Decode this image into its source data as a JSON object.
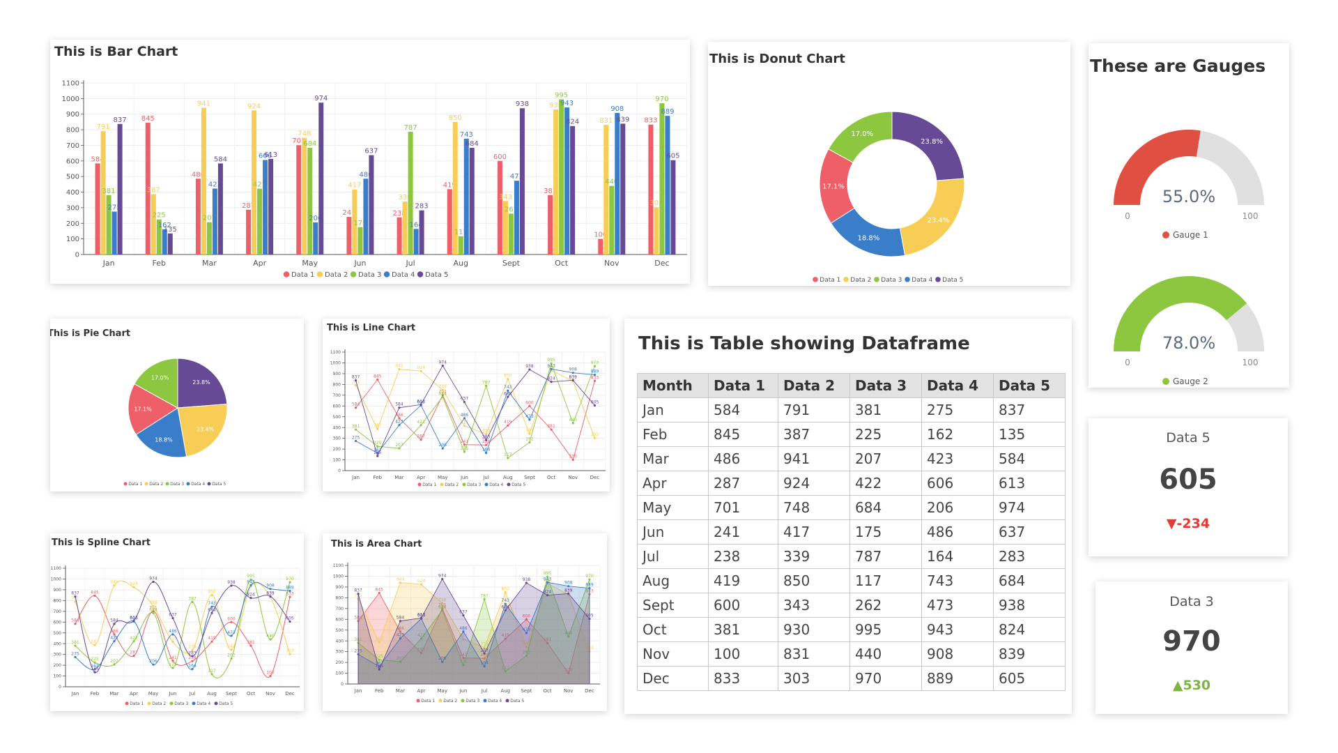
{
  "colors": [
    "#ee5f67",
    "#f7cd56",
    "#8dc63f",
    "#3a7dc9",
    "#674a95"
  ],
  "legend": [
    "Data 1",
    "Data 2",
    "Data 3",
    "Data 4",
    "Data 5"
  ],
  "months_short": [
    "Jan",
    "Feb",
    "Mar",
    "Apr",
    "May",
    "Jun",
    "Jul",
    "Aug",
    "Sept",
    "Oct",
    "Nov",
    "Dec"
  ],
  "titles": {
    "bar": "This is Bar Chart",
    "donut": "This is Donut Chart",
    "gauges": "These are Gauges",
    "pie": "This is Pie Chart",
    "line": "This is Line Chart",
    "table": "This is Table showing Dataframe",
    "spline": "This is Spline Chart",
    "area": "This is Area Chart"
  },
  "table": {
    "headers": [
      "Month",
      "Data 1",
      "Data 2",
      "Data 3",
      "Data 4",
      "Data 5"
    ],
    "rows": [
      [
        "Jan",
        "584",
        "791",
        "381",
        "275",
        "837"
      ],
      [
        "Feb",
        "845",
        "387",
        "225",
        "162",
        "135"
      ],
      [
        "Mar",
        "486",
        "941",
        "207",
        "423",
        "584"
      ],
      [
        "Apr",
        "287",
        "924",
        "422",
        "606",
        "613"
      ],
      [
        "May",
        "701",
        "748",
        "684",
        "206",
        "974"
      ],
      [
        "Jun",
        "241",
        "417",
        "175",
        "486",
        "637"
      ],
      [
        "Jul",
        "238",
        "339",
        "787",
        "164",
        "283"
      ],
      [
        "Aug",
        "419",
        "850",
        "117",
        "743",
        "684"
      ],
      [
        "Sept",
        "600",
        "343",
        "262",
        "473",
        "938"
      ],
      [
        "Oct",
        "381",
        "930",
        "995",
        "943",
        "824"
      ],
      [
        "Nov",
        "100",
        "831",
        "440",
        "908",
        "839"
      ],
      [
        "Dec",
        "833",
        "303",
        "970",
        "889",
        "605"
      ]
    ]
  },
  "gauges": [
    {
      "label": "Gauge 1",
      "value": 55.0,
      "display": "55.0%",
      "min": "0",
      "max": "100",
      "color": "#e05042"
    },
    {
      "label": "Gauge 2",
      "value": 78.0,
      "display": "78.0%",
      "min": "0",
      "max": "100",
      "color": "#8dc63f"
    }
  ],
  "kpis": [
    {
      "label": "Data 5",
      "value": "605",
      "delta": "▼-234",
      "delta_color": "#e53935"
    },
    {
      "label": "Data 3",
      "value": "970",
      "delta": "▲530",
      "delta_color": "#7cb342"
    }
  ],
  "chart_data": [
    {
      "type": "bar",
      "title": "This is Bar Chart",
      "categories": [
        "Jan",
        "Feb",
        "Mar",
        "Apr",
        "May",
        "Jun",
        "Jul",
        "Aug",
        "Sept",
        "Oct",
        "Nov",
        "Dec"
      ],
      "ylim": [
        0,
        1100
      ],
      "yticks": [
        0,
        100,
        200,
        300,
        400,
        500,
        600,
        700,
        800,
        900,
        1000,
        1100
      ],
      "legend_position": "bottom",
      "series": [
        {
          "name": "Data 1",
          "values": [
            584,
            845,
            486,
            287,
            701,
            241,
            238,
            419,
            600,
            381,
            100,
            833
          ]
        },
        {
          "name": "Data 2",
          "values": [
            791,
            387,
            941,
            924,
            748,
            417,
            339,
            850,
            343,
            930,
            831,
            303
          ]
        },
        {
          "name": "Data 3",
          "values": [
            381,
            225,
            207,
            422,
            684,
            175,
            787,
            117,
            262,
            995,
            440,
            970
          ]
        },
        {
          "name": "Data 4",
          "values": [
            275,
            162,
            423,
            606,
            206,
            486,
            164,
            743,
            473,
            943,
            908,
            889
          ]
        },
        {
          "name": "Data 5",
          "values": [
            837,
            135,
            584,
            613,
            974,
            637,
            283,
            684,
            938,
            824,
            839,
            605
          ]
        }
      ]
    },
    {
      "type": "pie",
      "variant": "donut",
      "title": "This is Donut Chart",
      "labels": [
        "Data 1",
        "Data 2",
        "Data 3",
        "Data 4",
        "Data 5"
      ],
      "values": [
        17.1,
        23.4,
        17.0,
        18.8,
        23.8
      ],
      "value_labels": [
        "17.1%",
        "23.4%",
        "17.0%",
        "18.8%",
        "23.8%"
      ],
      "legend_position": "bottom"
    },
    {
      "type": "pie",
      "title": "This is Pie Chart",
      "labels": [
        "Data 1",
        "Data 2",
        "Data 3",
        "Data 4",
        "Data 5"
      ],
      "values": [
        17.1,
        23.4,
        17.0,
        18.8,
        23.8
      ],
      "value_labels": [
        "17.1%",
        "23.4%",
        "17.0%",
        "18.8%",
        "23.8%"
      ],
      "legend_position": "bottom"
    },
    {
      "type": "line",
      "title": "This is Line Chart",
      "ylim": [
        0,
        1100
      ],
      "legend_position": "bottom"
    },
    {
      "type": "line",
      "variant": "spline",
      "title": "This is Spline Chart",
      "ylim": [
        0,
        1100
      ],
      "legend_position": "bottom"
    },
    {
      "type": "area",
      "title": "This is Area Chart",
      "ylim": [
        0,
        1100
      ],
      "legend_position": "bottom"
    }
  ]
}
